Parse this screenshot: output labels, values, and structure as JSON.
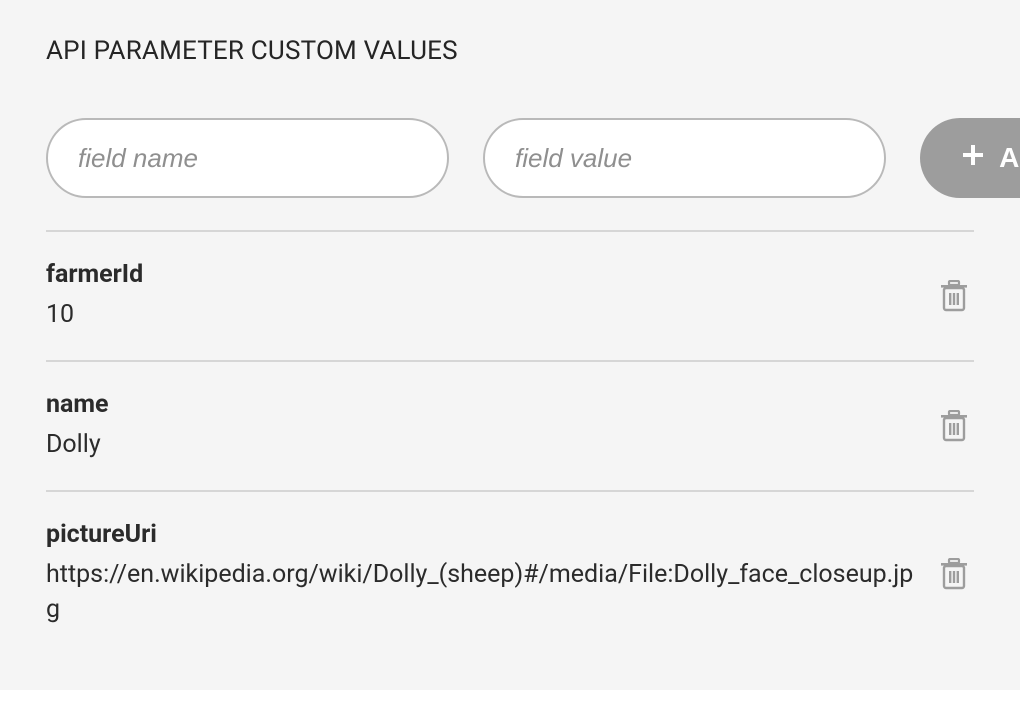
{
  "section_title": "API PARAMETER CUSTOM VALUES",
  "inputs": {
    "field_name_placeholder": "field name",
    "field_value_placeholder": "field value",
    "add_button_label": "ADD"
  },
  "items": [
    {
      "name": "farmerId",
      "value": "10"
    },
    {
      "name": "name",
      "value": "Dolly"
    },
    {
      "name": "pictureUri",
      "value": "https://en.wikipedia.org/wiki/Dolly_(sheep)#/media/File:Dolly_face_closeup.jpg"
    }
  ]
}
